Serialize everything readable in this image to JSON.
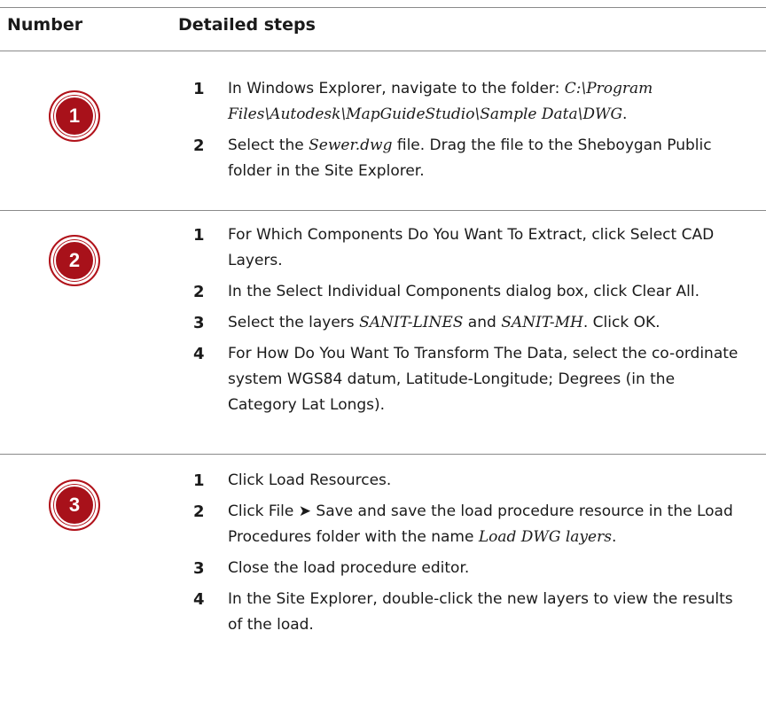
{
  "header": {
    "number_label": "Number",
    "steps_label": "Detailed steps"
  },
  "rows": [
    {
      "badge": "1",
      "steps": [
        {
          "num": "1",
          "parts": [
            {
              "text": "In Windows Explorer, navigate to the folder: ",
              "italic": false
            },
            {
              "text": "C:\\Program Files\\Autodesk\\MapGuideStudio\\Sample Data\\DWG",
              "italic": true
            },
            {
              "text": ".",
              "italic": false
            }
          ]
        },
        {
          "num": "2",
          "parts": [
            {
              "text": "Select the ",
              "italic": false
            },
            {
              "text": "Sewer.dwg",
              "italic": true
            },
            {
              "text": " file. Drag the file to the Sheboygan Public folder in the Site Explorer.",
              "italic": false
            }
          ]
        }
      ]
    },
    {
      "badge": "2",
      "steps": [
        {
          "num": "1",
          "parts": [
            {
              "text": "For Which Components Do You Want To Extract, click Select CAD Layers.",
              "italic": false
            }
          ]
        },
        {
          "num": "2",
          "parts": [
            {
              "text": "In the Select Individual Components dialog box, click Clear All.",
              "italic": false
            }
          ]
        },
        {
          "num": "3",
          "parts": [
            {
              "text": "Select the layers ",
              "italic": false
            },
            {
              "text": "SANIT-LINES",
              "italic": true
            },
            {
              "text": " and ",
              "italic": false
            },
            {
              "text": "SANIT-MH",
              "italic": true
            },
            {
              "text": ". Click OK.",
              "italic": false
            }
          ]
        },
        {
          "num": "4",
          "parts": [
            {
              "text": "For How Do You Want To Transform The Data, select the co-ordinate system WGS84 datum, Latitude-Longitude; Degrees (in the Category Lat Longs).",
              "italic": false
            }
          ]
        }
      ]
    },
    {
      "badge": "3",
      "steps": [
        {
          "num": "1",
          "parts": [
            {
              "text": "Click Load Resources.",
              "italic": false
            }
          ]
        },
        {
          "num": "2",
          "parts": [
            {
              "text": "Click File ➤ Save and save the load procedure resource in the Load Procedures folder with the name ",
              "italic": false
            },
            {
              "text": "Load DWG layers",
              "italic": true
            },
            {
              "text": ".",
              "italic": false
            }
          ]
        },
        {
          "num": "3",
          "parts": [
            {
              "text": "Close the load procedure editor.",
              "italic": false
            }
          ]
        },
        {
          "num": "4",
          "parts": [
            {
              "text": "In the Site Explorer, double-click the new layers to view the results of the load.",
              "italic": false
            }
          ]
        }
      ]
    }
  ],
  "colors": {
    "badge": "#b1121a",
    "rule": "#8a8a8a"
  }
}
